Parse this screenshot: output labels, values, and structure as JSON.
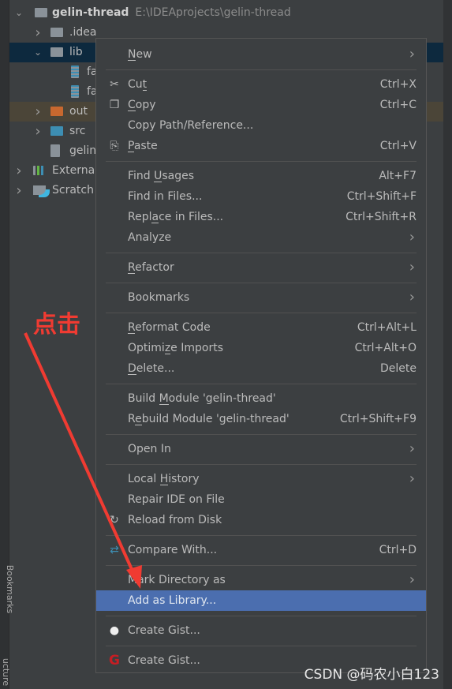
{
  "tree": {
    "project": {
      "name": "gelin-thread",
      "path": "E:\\IDEAprojects\\gelin-thread"
    },
    "items": [
      {
        "label": ".idea",
        "kind": "folder",
        "color": "#8a9299"
      },
      {
        "label": "lib",
        "kind": "folder",
        "color": "#8a9299",
        "selected": true
      },
      {
        "label": "fa",
        "kind": "jar"
      },
      {
        "label": "fa",
        "kind": "jar"
      },
      {
        "label": "out",
        "kind": "folder",
        "color": "#c8682f"
      },
      {
        "label": "src",
        "kind": "folder",
        "color": "#3d8eb3"
      },
      {
        "label": "gelin",
        "kind": "file"
      },
      {
        "label": "Externa",
        "kind": "libraries"
      },
      {
        "label": "Scratch",
        "kind": "scratches"
      }
    ]
  },
  "side_tabs": {
    "project": "Proj",
    "bookmarks": "Bookmarks",
    "structure": "ucture"
  },
  "menu": [
    {
      "label": "New",
      "mnemonic": 0,
      "submenu": true
    },
    {
      "sep": true
    },
    {
      "label": "Cut",
      "mnemonic": 2,
      "shortcut": "Ctrl+X",
      "icon": "scissors-icon"
    },
    {
      "label": "Copy",
      "mnemonic": 0,
      "shortcut": "Ctrl+C",
      "icon": "copy-icon"
    },
    {
      "label": "Copy Path/Reference..."
    },
    {
      "label": "Paste",
      "mnemonic": 0,
      "shortcut": "Ctrl+V",
      "icon": "paste-icon"
    },
    {
      "sep": true
    },
    {
      "label": "Find Usages",
      "mnemonic": 5,
      "shortcut": "Alt+F7"
    },
    {
      "label": "Find in Files...",
      "shortcut": "Ctrl+Shift+F"
    },
    {
      "label": "Replace in Files...",
      "mnemonic": 4,
      "shortcut": "Ctrl+Shift+R"
    },
    {
      "label": "Analyze",
      "submenu": true
    },
    {
      "sep": true
    },
    {
      "label": "Refactor",
      "mnemonic": 0,
      "submenu": true
    },
    {
      "sep": true
    },
    {
      "label": "Bookmarks",
      "submenu": true
    },
    {
      "sep": true
    },
    {
      "label": "Reformat Code",
      "mnemonic": 0,
      "shortcut": "Ctrl+Alt+L"
    },
    {
      "label": "Optimize Imports",
      "mnemonic": 6,
      "shortcut": "Ctrl+Alt+O"
    },
    {
      "label": "Delete...",
      "mnemonic": 0,
      "shortcut": "Delete"
    },
    {
      "sep": true
    },
    {
      "label": "Build Module 'gelin-thread'",
      "mnemonic": 6
    },
    {
      "label": "Rebuild Module 'gelin-thread'",
      "mnemonic": 1,
      "shortcut": "Ctrl+Shift+F9"
    },
    {
      "sep": true
    },
    {
      "label": "Open In",
      "submenu": true
    },
    {
      "sep": true
    },
    {
      "label": "Local History",
      "mnemonic": 6,
      "submenu": true
    },
    {
      "label": "Repair IDE on File"
    },
    {
      "label": "Reload from Disk",
      "icon": "reload-icon"
    },
    {
      "sep": true
    },
    {
      "label": "Compare With...",
      "shortcut": "Ctrl+D",
      "icon": "compare-icon"
    },
    {
      "sep": true
    },
    {
      "label": "Mark Directory as",
      "submenu": true
    },
    {
      "label": "Add as Library...",
      "highlighted": true
    },
    {
      "sep": true
    },
    {
      "label": "Create Gist...",
      "icon": "github-icon"
    },
    {
      "sep": true
    },
    {
      "label": "Create Gist...",
      "icon": "gitee-icon"
    }
  ],
  "annotation": {
    "text": "点击",
    "color": "#f03b32"
  },
  "watermark": "CSDN @码农小白123",
  "colors": {
    "highlight": "#4b6eaf",
    "selection": "#0d293e",
    "background": "#3c3f41"
  }
}
